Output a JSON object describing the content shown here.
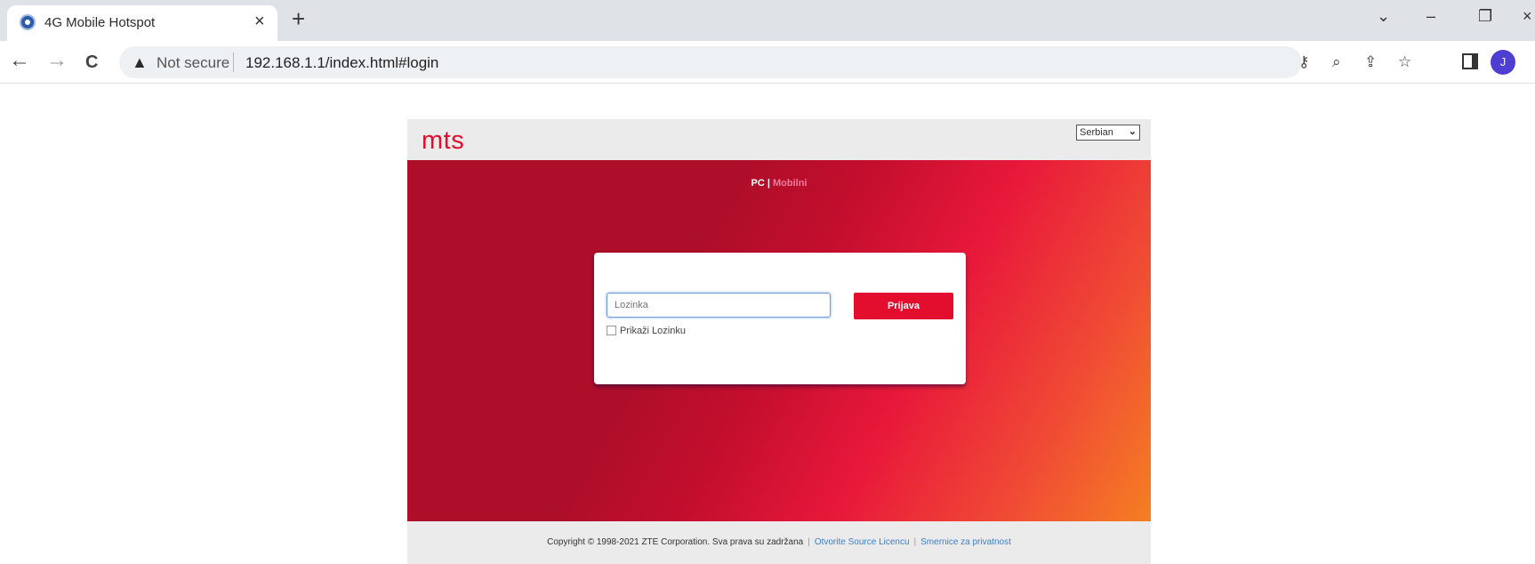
{
  "browser": {
    "tab_title": "4G Mobile Hotspot",
    "tab_close": "×",
    "new_tab": "+",
    "window_controls": {
      "tab_search": "⌄",
      "minimize": "–",
      "restore": "❐",
      "close": "×"
    },
    "back": "←",
    "forward": "→",
    "reload": "C",
    "security_label": "Not secure",
    "url": "192.168.1.1/index.html#login",
    "avatar_initial": "J",
    "icons": [
      "key-icon",
      "zoom-icon",
      "share-icon",
      "star-icon",
      "side-panel-icon"
    ]
  },
  "header": {
    "logo": "mts",
    "language": "Serbian"
  },
  "view_switch": {
    "pc": "PC",
    "separator": "|",
    "mobile": "Mobilni"
  },
  "login": {
    "password_placeholder": "Lozinka",
    "submit_label": "Prijava",
    "show_password_label": "Prikaži Lozinku"
  },
  "footer": {
    "copyright": "Copyright © 1998-2021 ZTE Corporation. Sva prava su zadržana",
    "license_link": "Otvorite Source Licencu",
    "privacy_link": "Smernice za privatnost",
    "separator": "|"
  },
  "colors": {
    "brand_red": "#e30e2d",
    "hero_dark": "#ad0e29",
    "hero_orange": "#f57f22"
  }
}
